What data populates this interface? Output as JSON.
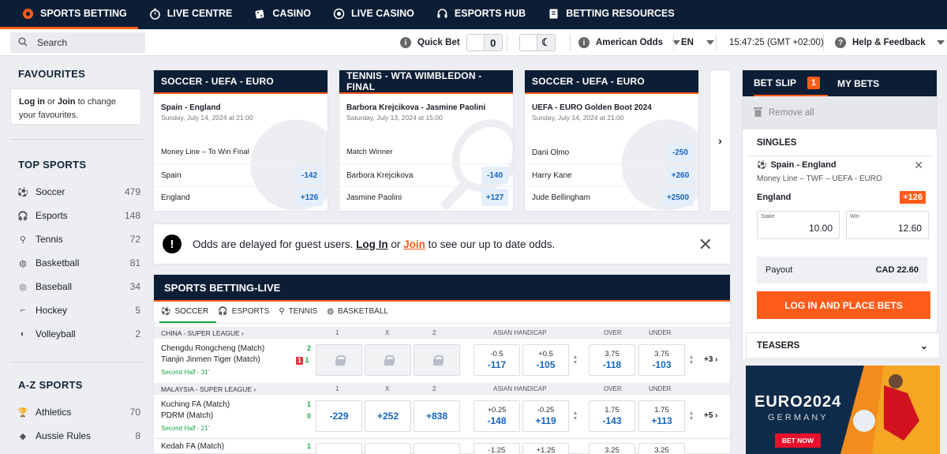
{
  "topnav": [
    {
      "label": "SPORTS BETTING",
      "icon": "soccer-ball-icon"
    },
    {
      "label": "LIVE CENTRE",
      "icon": "stopwatch-icon"
    },
    {
      "label": "CASINO",
      "icon": "dice-icon"
    },
    {
      "label": "LIVE CASINO",
      "icon": "roulette-icon"
    },
    {
      "label": "ESPORTS HUB",
      "icon": "headset-icon"
    },
    {
      "label": "BETTING RESOURCES",
      "icon": "book-icon"
    }
  ],
  "subbar": {
    "search_label": "Search",
    "quick_bet_label": "Quick Bet",
    "quick_bet_value": "0",
    "odds_format": "American Odds",
    "language": "EN",
    "clock": "15:47:25 (GMT +02:00)",
    "help": "Help & Feedback"
  },
  "favourites": {
    "title": "FAVOURITES",
    "login": "Log in",
    "or": " or ",
    "join": "Join",
    "rest": " to change your favourites."
  },
  "top_sports": {
    "title": "TOP SPORTS",
    "items": [
      {
        "label": "Soccer",
        "count": "479"
      },
      {
        "label": "Esports",
        "count": "148"
      },
      {
        "label": "Tennis",
        "count": "72"
      },
      {
        "label": "Basketball",
        "count": "81"
      },
      {
        "label": "Baseball",
        "count": "34"
      },
      {
        "label": "Hockey",
        "count": "5"
      },
      {
        "label": "Volleyball",
        "count": "2"
      }
    ]
  },
  "az_sports": {
    "title": "A-Z SPORTS",
    "items": [
      {
        "label": "Athletics",
        "count": "70"
      },
      {
        "label": "Aussie Rules",
        "count": "8"
      }
    ]
  },
  "cards": [
    {
      "header": "SOCCER - UEFA - EURO",
      "match": "Spain - England",
      "date": "Sunday, July 14, 2024 at 21:00",
      "market": "Money Line – To Win Final",
      "rows": [
        {
          "name": "Spain",
          "odd": "-142"
        },
        {
          "name": "England",
          "odd": "+126"
        }
      ]
    },
    {
      "header": "TENNIS - WTA WIMBLEDON - FINAL",
      "match": "Barbora Krejcikova - Jasmine Paolini",
      "date": "Saturday, July 13, 2024 at 15:00",
      "market": "Match Winner",
      "rows": [
        {
          "name": "Barbora Krejcikova",
          "odd": "-140"
        },
        {
          "name": "Jasmine Paolini",
          "odd": "+127"
        }
      ]
    },
    {
      "header": "SOCCER - UEFA - EURO",
      "match": "UEFA - EURO Golden Boot 2024",
      "date": "Sunday, July 14, 2024 at 21:00",
      "market": "",
      "rows": [
        {
          "name": "Dani Olmo",
          "odd": "-250"
        },
        {
          "name": "Harry Kane",
          "odd": "+260"
        },
        {
          "name": "Jude Bellingham",
          "odd": "+2500"
        }
      ]
    }
  ],
  "notice": {
    "text1": "Odds are delayed for guest users. ",
    "login": "Log In",
    "or": " or ",
    "join": "Join",
    "text2": " to see our up to date odds."
  },
  "live": {
    "title": "SPORTS BETTING-LIVE",
    "tabs": [
      "SOCCER",
      "ESPORTS",
      "TENNIS",
      "BASKETBALL"
    ],
    "col_headers": {
      "c1": "1",
      "cx": "X",
      "c2": "2",
      "ah": "ASIAN HANDICAP",
      "over": "OVER",
      "under": "UNDER"
    },
    "leagues": [
      {
        "name": "CHINA - SUPER LEAGUE",
        "home": "Chengdu Rongcheng (Match)",
        "away": "Tianjin Jinmen Tiger (Match)",
        "home_score": "2",
        "away_score": "1",
        "red_cards": "1",
        "period": "Second Half - 31'",
        "o1": "",
        "ox": "",
        "o2": "",
        "ah1_h": "-0.5",
        "ah1_o": "-117",
        "ah2_h": "+0.5",
        "ah2_o": "-105",
        "ov_h": "3.75",
        "ov_o": "-118",
        "un_h": "3.75",
        "un_o": "-103",
        "more": "+3"
      },
      {
        "name": "MALAYSIA - SUPER LEAGUE",
        "home": "Kuching FA (Match)",
        "away": "PDRM (Match)",
        "home_score": "1",
        "away_score": "0",
        "period": "Second Half - 21'",
        "o1": "-229",
        "ox": "+252",
        "o2": "+838",
        "ah1_h": "+0.25",
        "ah1_o": "-148",
        "ah2_h": "-0.25",
        "ah2_o": "+119",
        "ov_h": "1.75",
        "ov_o": "-143",
        "un_h": "1.75",
        "un_o": "+113",
        "more": "+5"
      },
      {
        "home": "Kedah FA (Match)",
        "home_score": "1",
        "ah1_h": "-1.25",
        "ah2_h": "+1.25",
        "ov_h": "3.25",
        "un_h": "3.25"
      }
    ]
  },
  "betslip": {
    "tab1": "BET SLIP",
    "count": "1",
    "tab2": "MY BETS",
    "remove_all": "Remove all",
    "singles": "SINGLES",
    "event": "Spain - England",
    "market": "Money Line – TWF – UEFA - EURO",
    "selection": "England",
    "odd": "+126",
    "stake_label": "Stake",
    "stake_value": "10.00",
    "win_label": "Win",
    "win_value": "12.60",
    "payout_label": "Payout",
    "payout_value": "CAD 22.60",
    "place_button": "LOG IN AND PLACE BETS",
    "teasers": "TEASERS"
  },
  "banner": {
    "title": "EURO2024",
    "subtitle": "GERMANY",
    "cta": "BET NOW"
  },
  "colors": {
    "navy": "#0c1e35",
    "accent": "#ff5c1a",
    "odds_blue": "#1764c0",
    "live_green": "#1aa84a"
  }
}
